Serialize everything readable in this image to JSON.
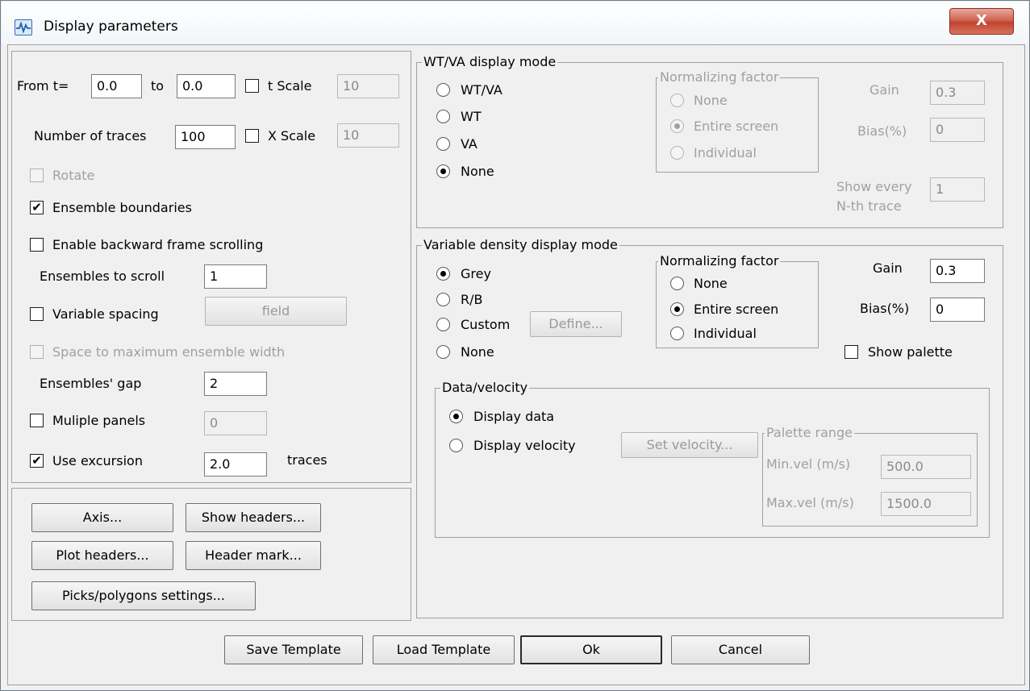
{
  "window": {
    "title": "Display parameters",
    "close_label": "X"
  },
  "time": {
    "from_label": "From t=",
    "from_value": "0.0",
    "to_label": "to",
    "to_value": "0.0",
    "tscale_label": "t Scale",
    "tscale_value": "10"
  },
  "traces": {
    "label": "Number of traces",
    "value": "100",
    "xscale_label": "X Scale",
    "xscale_value": "10"
  },
  "options": {
    "rotate": "Rotate",
    "ensemble_boundaries": "Ensemble boundaries",
    "backward_scrolling": "Enable backward frame scrolling",
    "ensembles_to_scroll_label": "Ensembles to scroll",
    "ensembles_to_scroll_value": "1",
    "variable_spacing": "Variable spacing",
    "field_button": "field",
    "space_to_max": "Space to maximum ensemble width",
    "ensembles_gap_label": "Ensembles' gap",
    "ensembles_gap_value": "2",
    "multiple_panels": "Muliple panels",
    "multiple_panels_value": "0",
    "use_excursion": "Use excursion",
    "excursion_value": "2.0",
    "traces_unit": "traces"
  },
  "buttons_left": {
    "axis": "Axis...",
    "show_headers": "Show headers...",
    "plot_headers": "Plot headers...",
    "header_mark": "Header mark...",
    "picks": "Picks/polygons settings..."
  },
  "wtva": {
    "title": "WT/VA display mode",
    "modes": [
      "WT/VA",
      "WT",
      "VA",
      "None"
    ],
    "norm_title": "Normalizing factor",
    "norm": [
      "None",
      "Entire screen",
      "Individual"
    ],
    "gain_label": "Gain",
    "gain_value": "0.3",
    "bias_label": "Bias(%)",
    "bias_value": "0",
    "show_every_label_1": "Show every",
    "show_every_label_2": "N-th trace",
    "show_every_value": "1"
  },
  "vd": {
    "title": "Variable density display mode",
    "modes": [
      "Grey",
      "R/B",
      "Custom",
      "None"
    ],
    "define_button": "Define...",
    "norm_title": "Normalizing factor",
    "norm": [
      "None",
      "Entire screen",
      "Individual"
    ],
    "gain_label": "Gain",
    "gain_value": "0.3",
    "bias_label": "Bias(%)",
    "bias_value": "0",
    "show_palette": "Show palette"
  },
  "data_velocity": {
    "title": "Data/velocity",
    "display_data": "Display data",
    "display_velocity": "Display velocity",
    "set_velocity": "Set velocity...",
    "palette_title": "Palette range",
    "min_label": "Min.vel (m/s)",
    "min_value": "500.0",
    "max_label": "Max.vel (m/s)",
    "max_value": "1500.0"
  },
  "footer": {
    "save": "Save Template",
    "load": "Load Template",
    "ok": "Ok",
    "cancel": "Cancel"
  }
}
